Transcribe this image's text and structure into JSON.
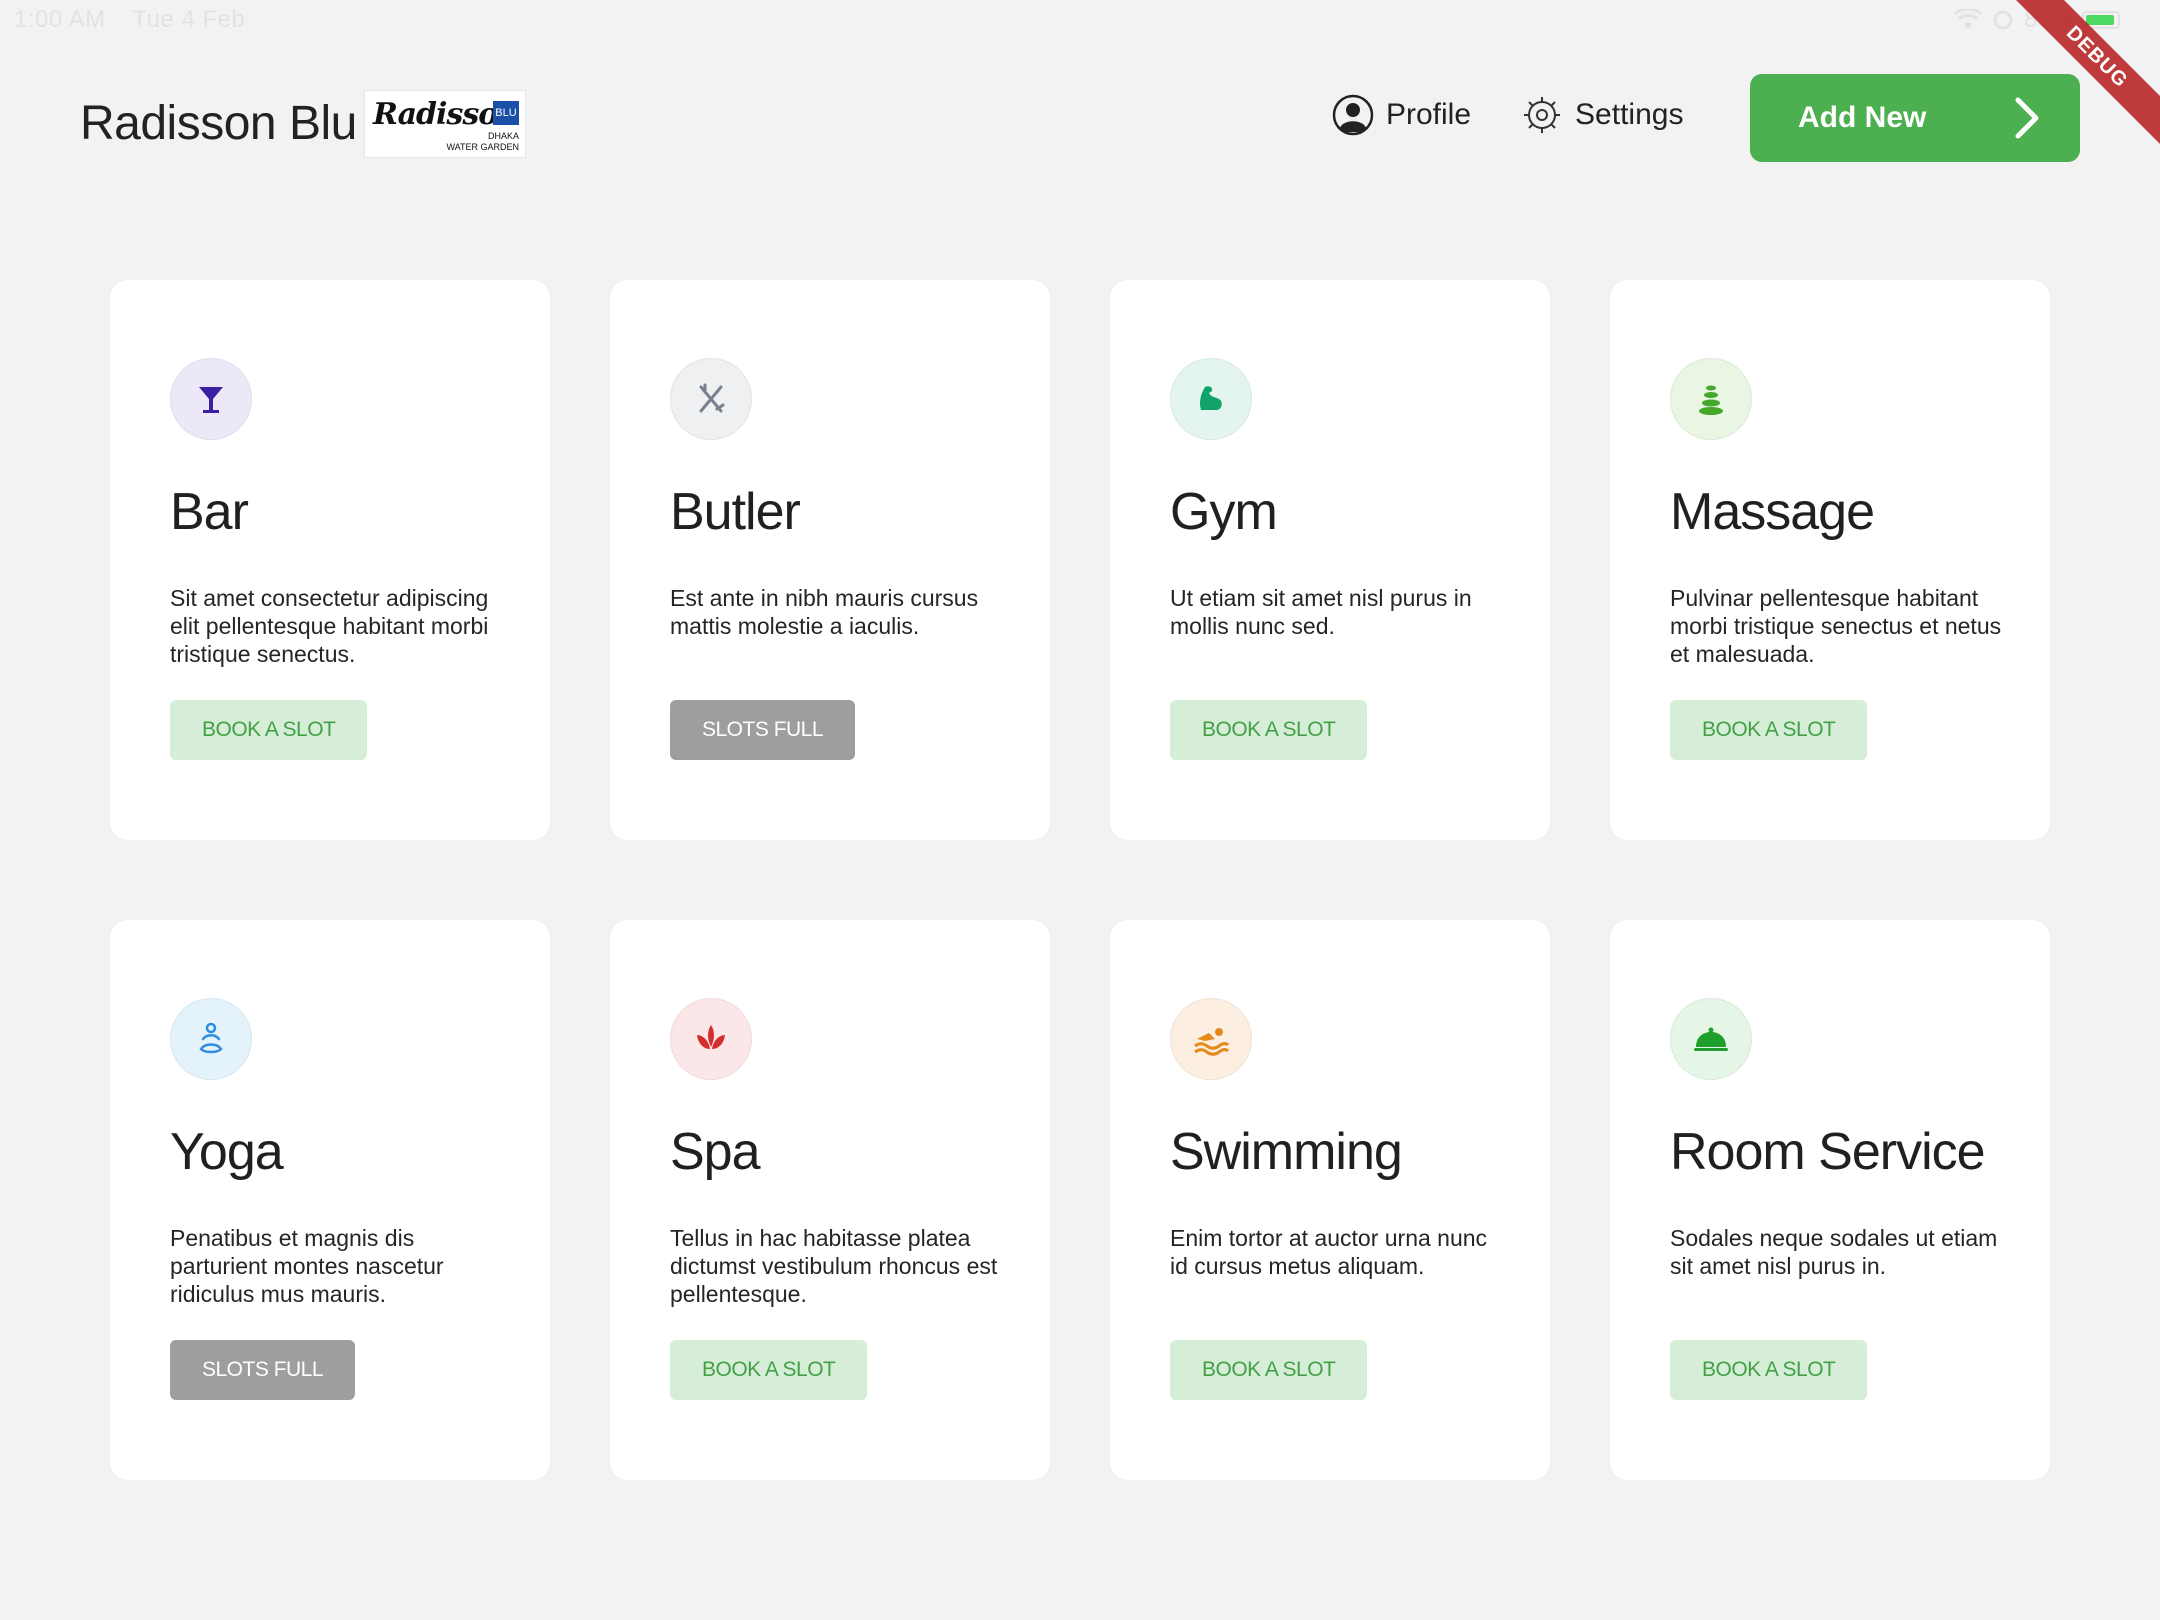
{
  "status_bar": {
    "time": "1:00 AM",
    "date": "Tue 4 Feb",
    "battery": "89%"
  },
  "debug_label": "DEBUG",
  "header": {
    "title": "Radisson Blu",
    "logo": {
      "script": "Radisson",
      "badge": "BLU",
      "sub_line1": "DHAKA",
      "sub_line2": "WATER GARDEN"
    },
    "nav": {
      "profile": "Profile",
      "settings": "Settings"
    },
    "add_new": "Add New"
  },
  "services": [
    {
      "title": "Bar",
      "description": "Sit amet consectetur adipiscing elit pellentesque habitant morbi tristique senectus.",
      "button": "BOOK A SLOT",
      "status": "available",
      "icon": "cocktail-icon",
      "icon_color": "#3d1fa3",
      "icon_bg": "#ece8f8"
    },
    {
      "title": "Butler",
      "description": "Est ante in nibh mauris cursus mattis molestie a iaculis.",
      "button": "SLOTS FULL",
      "status": "full",
      "icon": "butler-tools-icon",
      "icon_color": "#7a7f8c",
      "icon_bg": "#eef0f2"
    },
    {
      "title": "Gym",
      "description": "Ut etiam sit amet nisl purus in mollis nunc sed.",
      "button": "BOOK A SLOT",
      "status": "available",
      "icon": "flexed-arm-icon",
      "icon_color": "#12a36a",
      "icon_bg": "#e3f5ee"
    },
    {
      "title": "Massage",
      "description": "Pulvinar pellentesque habitant morbi tristique senectus et netus et malesuada.",
      "button": "BOOK A SLOT",
      "status": "available",
      "icon": "spa-stones-icon",
      "icon_color": "#46a82a",
      "icon_bg": "#e8f6e3"
    },
    {
      "title": "Yoga",
      "description": "Penatibus et magnis dis parturient montes nascetur ridiculus mus mauris.",
      "button": "SLOTS FULL",
      "status": "full",
      "icon": "meditation-icon",
      "icon_color": "#2f8de0",
      "icon_bg": "#e4f2fc"
    },
    {
      "title": "Spa",
      "description": "Tellus in hac habitasse platea dictumst vestibulum rhoncus est pellentesque.",
      "button": "BOOK A SLOT",
      "status": "available",
      "icon": "lotus-icon",
      "icon_color": "#d32f2f",
      "icon_bg": "#fbe7e7"
    },
    {
      "title": "Swimming",
      "description": "Enim tortor at auctor urna nunc id cursus metus aliquam.",
      "button": "BOOK A SLOT",
      "status": "available",
      "icon": "swimmer-icon",
      "icon_color": "#e58a1a",
      "icon_bg": "#fcefe1"
    },
    {
      "title": "Room Service",
      "description": "Sodales neque sodales ut etiam sit amet nisl purus in.",
      "button": "BOOK A SLOT",
      "status": "available",
      "icon": "cloche-icon",
      "icon_color": "#1e9e2b",
      "icon_bg": "#e5f5e6"
    }
  ],
  "colors": {
    "accent": "#4caf50",
    "book_bg": "#d6eed7",
    "book_text": "#43a047",
    "full_bg": "#9e9e9e",
    "page_bg": "#f2f2f2"
  }
}
